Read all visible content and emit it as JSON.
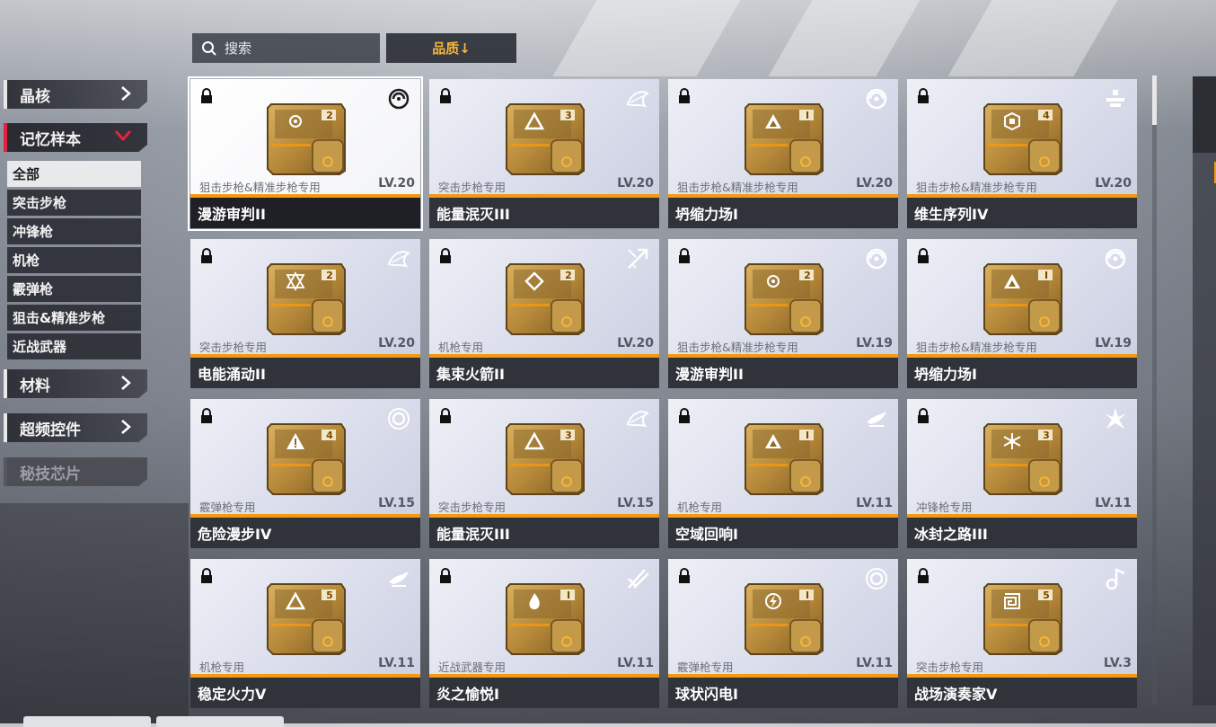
{
  "search": {
    "placeholder": "搜索"
  },
  "sort": {
    "label": "品质↓"
  },
  "nav": {
    "categories": [
      {
        "label": "晶核"
      },
      {
        "label": "记忆样本"
      },
      {
        "label": "材料"
      },
      {
        "label": "超频控件"
      },
      {
        "label": "秘技芯片"
      }
    ],
    "subcategories": [
      {
        "label": "全部"
      },
      {
        "label": "突击步枪"
      },
      {
        "label": "冲锋枪"
      },
      {
        "label": "机枪"
      },
      {
        "label": "霰弹枪"
      },
      {
        "label": "狙击&精准步枪"
      },
      {
        "label": "近战武器"
      }
    ]
  },
  "items": [
    {
      "name": "漫游审判II",
      "weapon": "狙击步枪&精准步枪专用",
      "level": "LV.20",
      "rank": "2",
      "type_icon": "swirl-icon"
    },
    {
      "name": "能量泯灭III",
      "weapon": "突击步枪专用",
      "level": "LV.20",
      "rank": "3",
      "type_icon": "feather-icon"
    },
    {
      "name": "坍缩力场I",
      "weapon": "狙击步枪&精准步枪专用",
      "level": "LV.20",
      "rank": "I",
      "type_icon": "vortex-icon"
    },
    {
      "name": "维生序列IV",
      "weapon": "狙击步枪&精准步枪专用",
      "level": "LV.20",
      "rank": "4",
      "type_icon": "medic-icon"
    },
    {
      "name": "电能涌动II",
      "weapon": "突击步枪专用",
      "level": "LV.20",
      "rank": "2",
      "type_icon": "feather-icon"
    },
    {
      "name": "集束火箭II",
      "weapon": "机枪专用",
      "level": "LV.20",
      "rank": "2",
      "type_icon": "missile-icon"
    },
    {
      "name": "漫游审判II",
      "weapon": "狙击步枪&精准步枪专用",
      "level": "LV.19",
      "rank": "2",
      "type_icon": "vortex-icon"
    },
    {
      "name": "坍缩力场I",
      "weapon": "狙击步枪&精准步枪专用",
      "level": "LV.19",
      "rank": "I",
      "type_icon": "vortex-icon"
    },
    {
      "name": "危险漫步IV",
      "weapon": "霰弹枪专用",
      "level": "LV.15",
      "rank": "4",
      "type_icon": "ring-icon"
    },
    {
      "name": "能量泯灭III",
      "weapon": "突击步枪专用",
      "level": "LV.15",
      "rank": "3",
      "type_icon": "feather-icon"
    },
    {
      "name": "空域回响I",
      "weapon": "机枪专用",
      "level": "LV.11",
      "rank": "I",
      "type_icon": "wing-icon"
    },
    {
      "name": "冰封之路III",
      "weapon": "冲锋枪专用",
      "level": "LV.11",
      "rank": "3",
      "type_icon": "ice-icon"
    },
    {
      "name": "稳定火力V",
      "weapon": "机枪专用",
      "level": "LV.11",
      "rank": "5",
      "type_icon": "wing-icon"
    },
    {
      "name": "炎之愉悦I",
      "weapon": "近战武器专用",
      "level": "LV.11",
      "rank": "I",
      "type_icon": "blade-icon"
    },
    {
      "name": "球状闪电I",
      "weapon": "霰弹枪专用",
      "level": "LV.11",
      "rank": "I",
      "type_icon": "ring-icon"
    },
    {
      "name": "战场演奏家V",
      "weapon": "突击步枪专用",
      "level": "LV.3",
      "rank": "5",
      "type_icon": "music-icon"
    }
  ],
  "colors": {
    "accent_orange": "#f39a12",
    "active_red": "#e6213e",
    "sort_gold": "#f4b63a",
    "chip_gold": "#b7893a"
  }
}
